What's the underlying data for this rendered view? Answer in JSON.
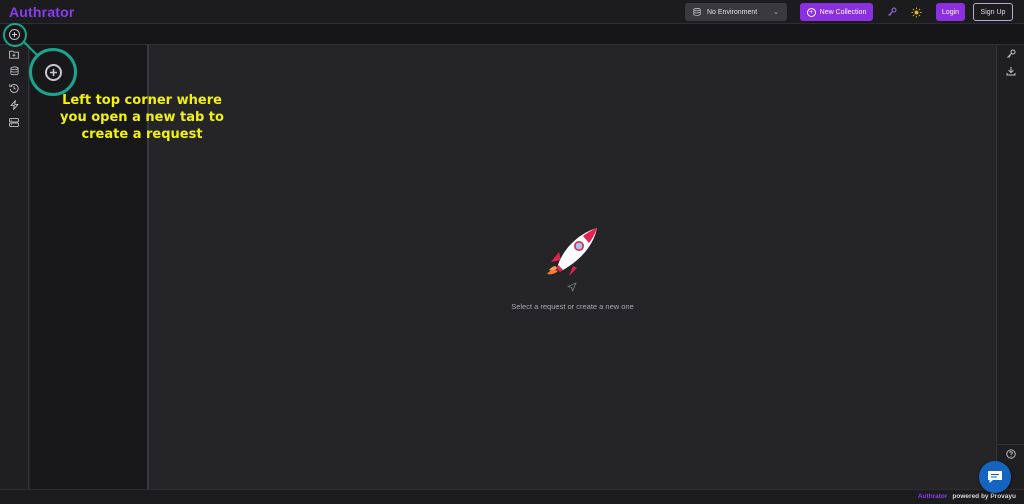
{
  "app": {
    "brand": "Authrator"
  },
  "header": {
    "environment": {
      "selected": "No Environment",
      "icon": "database-icon"
    },
    "new_collection_label": "New Collection",
    "login_label": "Login",
    "signup_label": "Sign Up",
    "icons": [
      "key-icon",
      "sun-icon"
    ]
  },
  "tabbar": {
    "new_tab_icon": "plus-circle-icon"
  },
  "sidebar": {
    "items": [
      {
        "name": "collections",
        "icon": "folder-icon"
      },
      {
        "name": "environments",
        "icon": "database-icon"
      },
      {
        "name": "history",
        "icon": "history-icon"
      },
      {
        "name": "flows",
        "icon": "lightning-icon"
      },
      {
        "name": "servers",
        "icon": "server-icon"
      }
    ]
  },
  "main": {
    "empty_message": "Select a request or create a new one"
  },
  "right_rail": {
    "items": [
      "key-icon",
      "download-icon",
      "help-icon"
    ]
  },
  "footer": {
    "brand": "Authrator",
    "powered_by": "powered by Provayu"
  },
  "annotation": {
    "text": "Left top corner where you open a new tab to create a request"
  },
  "colors": {
    "accent": "#8b2fe0",
    "highlight": "#1aa58d",
    "annotation_text": "#f2f20c",
    "chat": "#1565c0"
  }
}
